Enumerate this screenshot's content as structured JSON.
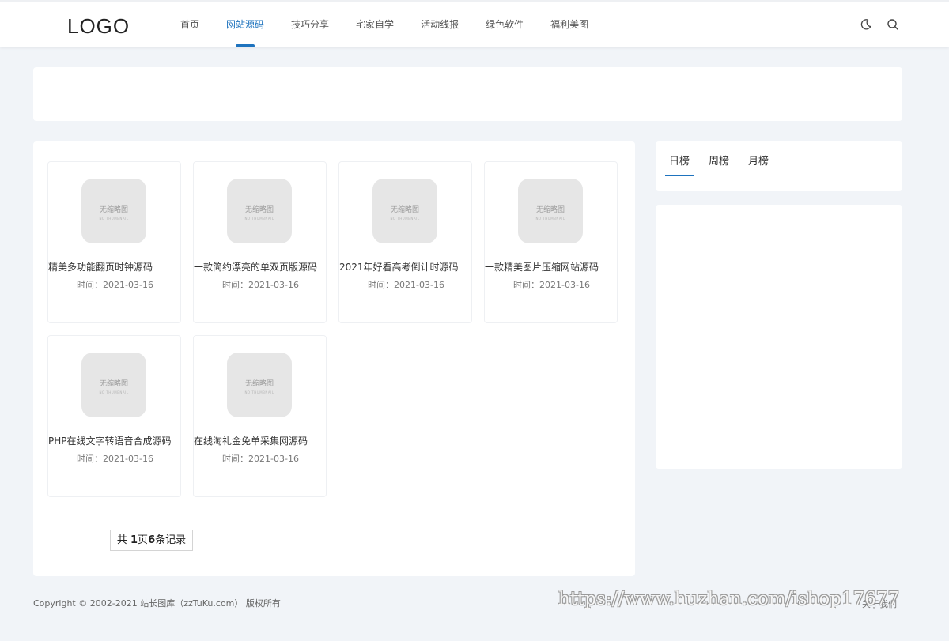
{
  "header": {
    "logo": "LOGO",
    "nav": [
      {
        "label": "首页"
      },
      {
        "label": "网站源码",
        "active": true
      },
      {
        "label": "技巧分享"
      },
      {
        "label": "宅家自学"
      },
      {
        "label": "活动线报"
      },
      {
        "label": "绿色软件"
      },
      {
        "label": "福利美图"
      }
    ],
    "icons": [
      "moon-icon",
      "search-icon"
    ],
    "accent_color": "#1e73be"
  },
  "placeholder": {
    "main": "无缩略图",
    "sub": "NO THUMBNAIL"
  },
  "posts": [
    {
      "title": "精美多功能翻页时钟源码",
      "date": "时间：2021-03-16"
    },
    {
      "title": "一款简约漂亮的单双页版源码",
      "date": "时间：2021-03-16"
    },
    {
      "title": "2021年好看高考倒计时源码",
      "date": "时间：2021-03-16"
    },
    {
      "title": "一款精美图片压缩网站源码",
      "date": "时间：2021-03-16"
    },
    {
      "title": "PHP在线文字转语音合成源码",
      "date": "时间：2021-03-16"
    },
    {
      "title": "在线淘礼金免单采集网源码",
      "date": "时间：2021-03-16"
    }
  ],
  "pagination": {
    "prefix": "共 ",
    "pages": "1",
    "mid": "页",
    "records": "6",
    "suffix": "条记录"
  },
  "ranking": {
    "tabs": [
      "日榜",
      "周榜",
      "月榜"
    ],
    "active": 0
  },
  "footer": {
    "copyright": "Copyright © 2002-2021 站长图库（zzTuKu.com） 版权所有",
    "watermark": "https://www.huzhan.com/ishop17677",
    "right_text": "关于我们"
  }
}
